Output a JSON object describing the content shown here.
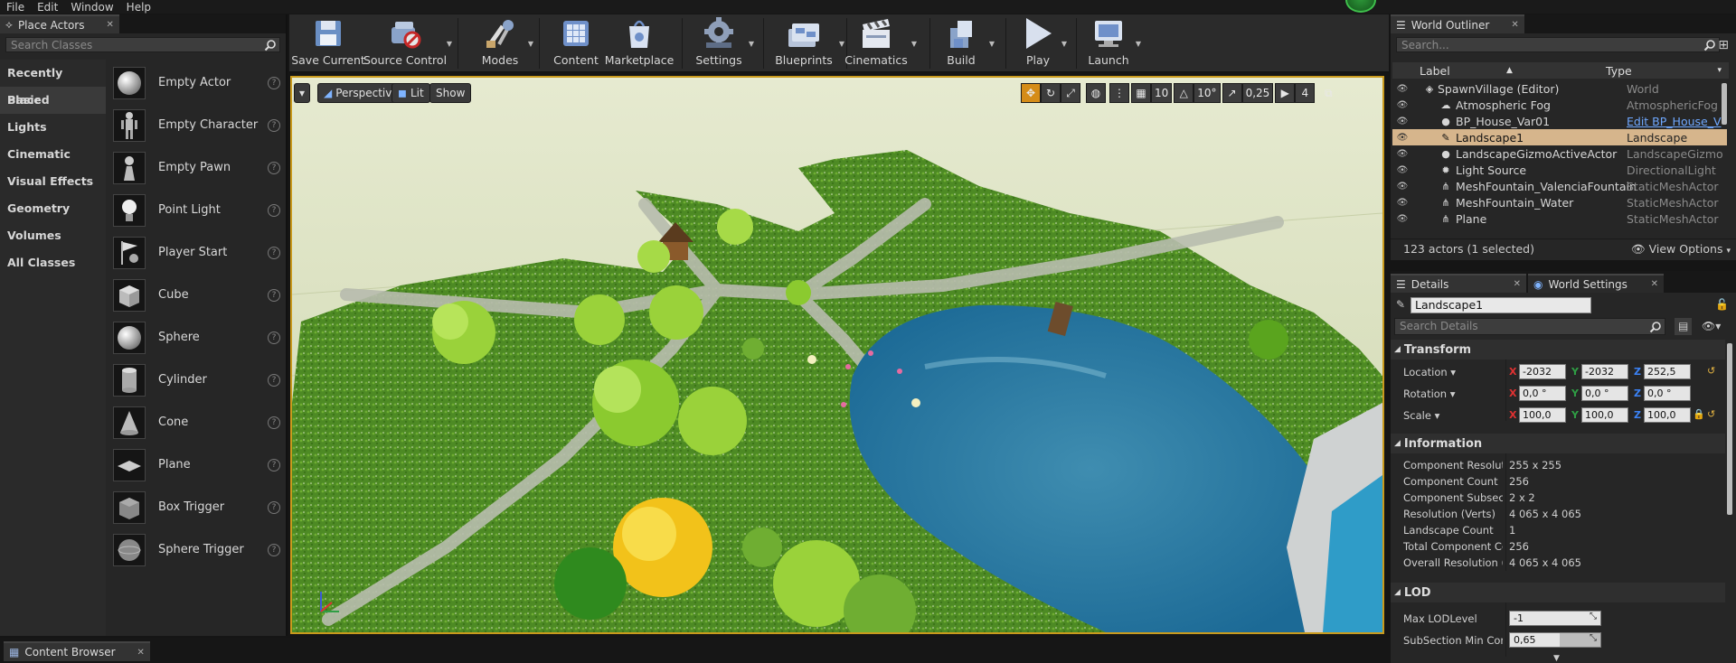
{
  "menu": [
    "File",
    "Edit",
    "Window",
    "Help"
  ],
  "place_actors": {
    "tab_title": "Place Actors",
    "search_placeholder": "Search Classes",
    "categories": [
      "Recently Placed",
      "Basic",
      "Lights",
      "Cinematic",
      "Visual Effects",
      "Geometry",
      "Volumes",
      "All Classes"
    ],
    "selected_category": "Basic",
    "actors": [
      {
        "label": "Empty Actor",
        "icon": "sphere-icon"
      },
      {
        "label": "Empty Character",
        "icon": "mannequin-icon"
      },
      {
        "label": "Empty Pawn",
        "icon": "pawn-icon"
      },
      {
        "label": "Point Light",
        "icon": "bulb-icon"
      },
      {
        "label": "Player Start",
        "icon": "flag-icon"
      },
      {
        "label": "Cube",
        "icon": "cube-icon"
      },
      {
        "label": "Sphere",
        "icon": "sphere-icon"
      },
      {
        "label": "Cylinder",
        "icon": "cylinder-icon"
      },
      {
        "label": "Cone",
        "icon": "cone-icon"
      },
      {
        "label": "Plane",
        "icon": "plane-icon"
      },
      {
        "label": "Box Trigger",
        "icon": "box-trigger-icon"
      },
      {
        "label": "Sphere Trigger",
        "icon": "sphere-trigger-icon"
      }
    ]
  },
  "toolbar": {
    "buttons": [
      {
        "label": "Save Current",
        "icon": "save-icon"
      },
      {
        "label": "Source Control",
        "icon": "source-control-icon"
      },
      {
        "label": "Modes",
        "icon": "modes-icon"
      },
      {
        "label": "Content",
        "icon": "content-icon"
      },
      {
        "label": "Marketplace",
        "icon": "marketplace-icon"
      },
      {
        "label": "Settings",
        "icon": "settings-icon"
      },
      {
        "label": "Blueprints",
        "icon": "blueprints-icon"
      },
      {
        "label": "Cinematics",
        "icon": "cinematics-icon"
      },
      {
        "label": "Build",
        "icon": "build-icon"
      },
      {
        "label": "Play",
        "icon": "play-icon"
      },
      {
        "label": "Launch",
        "icon": "launch-icon"
      }
    ]
  },
  "viewport": {
    "view_mode": "Perspective",
    "lighting": "Lit",
    "show": "Show",
    "grid_snap": "10",
    "rotation_snap": "10°",
    "scale_snap": "0,25",
    "camera_speed": "4",
    "axis_labels": [
      "Z",
      "X",
      "Y"
    ]
  },
  "bottom": {
    "content_browser_tab": "Content Browser"
  },
  "world_outliner": {
    "tab_title": "World Outliner",
    "search_placeholder": "Search...",
    "col_label": "Label",
    "col_type": "Type",
    "rows": [
      {
        "label": "SpawnVillage (Editor)",
        "type": "World",
        "icon": "world-icon"
      },
      {
        "label": "Atmospheric Fog",
        "type": "AtmosphericFog",
        "icon": "fog-icon"
      },
      {
        "label": "BP_House_Var01",
        "type": "Edit BP_House_V",
        "icon": "blueprint-icon"
      },
      {
        "label": "Landscape1",
        "type": "Landscape",
        "icon": "landscape-icon"
      },
      {
        "label": "LandscapeGizmoActiveActor",
        "type": "LandscapeGizmo",
        "icon": "gizmo-icon"
      },
      {
        "label": "Light Source",
        "type": "DirectionalLight",
        "icon": "sun-icon"
      },
      {
        "label": "MeshFountain_ValenciaFountain",
        "type": "StaticMeshActor",
        "icon": "mesh-icon"
      },
      {
        "label": "MeshFountain_Water",
        "type": "StaticMeshActor",
        "icon": "mesh-icon"
      },
      {
        "label": "Plane",
        "type": "StaticMeshActor",
        "icon": "mesh-icon"
      }
    ],
    "selected_row": "Landscape1",
    "status": "123 actors (1 selected)",
    "view_options": "View Options"
  },
  "details": {
    "tab_details": "Details",
    "tab_world_settings": "World Settings",
    "actor_name": "Landscape1",
    "search_placeholder": "Search Details",
    "transform": {
      "title": "Transform",
      "location_label": "Location",
      "rotation_label": "Rotation",
      "scale_label": "Scale",
      "location": [
        "-2032",
        "-2032",
        "252,5"
      ],
      "rotation": [
        "0,0 °",
        "0,0 °",
        "0,0 °"
      ],
      "scale": [
        "100,0",
        "100,0",
        "100,0"
      ]
    },
    "information": {
      "title": "Information",
      "rows": [
        {
          "label": "Component Resolution",
          "value": "255 x 255"
        },
        {
          "label": "Component Count",
          "value": "256"
        },
        {
          "label": "Component Subsection",
          "value": "2 x 2"
        },
        {
          "label": "Resolution (Verts)",
          "value": "4 065 x 4 065"
        },
        {
          "label": "Landscape Count",
          "value": "1"
        },
        {
          "label": "Total Component Count",
          "value": "256"
        },
        {
          "label": "Overall Resolution (Verts)",
          "value": "4 065 x 4 065"
        }
      ]
    },
    "lod": {
      "title": "LOD",
      "max_lod_label": "Max LODLevel",
      "max_lod_value": "-1",
      "subsection_label": "SubSection Min Component",
      "subsection_value": "0,65"
    }
  },
  "colors": {
    "accent": "#d58c18",
    "selection": "#d6b58c",
    "viewport_border": "#c99a1d",
    "link": "#6fa8ff"
  }
}
